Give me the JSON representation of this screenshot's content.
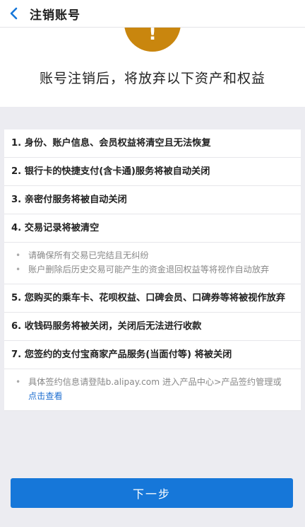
{
  "nav": {
    "title": "注销账号"
  },
  "hero": {
    "icon": "exclamation-icon",
    "icon_text": "!",
    "title": "账号注销后，将放弃以下资产和权益"
  },
  "items": [
    {
      "text": "1. 身份、账户信息、会员权益将清空且无法恢复"
    },
    {
      "text": "2. 银行卡的快捷支付(含卡通)服务将被自动关闭"
    },
    {
      "text": "3. 亲密付服务将被自动关闭"
    },
    {
      "text": "4. 交易记录将被清空"
    }
  ],
  "notes_4": [
    "请确保所有交易已完结且无纠纷",
    "账户删除后历史交易可能产生的资金退回权益等将视作自动放弃"
  ],
  "items_2": [
    {
      "text": "5. 您购买的乘车卡、花呗权益、口碑会员、口碑券等将被视作放弃"
    },
    {
      "text": "6. 收钱码服务将被关闭，关闭后无法进行收款"
    },
    {
      "text": "7. 您签约的支付宝商家产品服务(当面付等) 将被关闭"
    }
  ],
  "note_7": {
    "text": "具体签约信息请登陆b.alipay.com 进入产品中心>产品签约管理或 ",
    "link": "点击查看"
  },
  "button": {
    "next": "下一步"
  },
  "colors": {
    "accent": "#1677d9",
    "warning": "#c9860e",
    "link": "#1f6fd0"
  }
}
